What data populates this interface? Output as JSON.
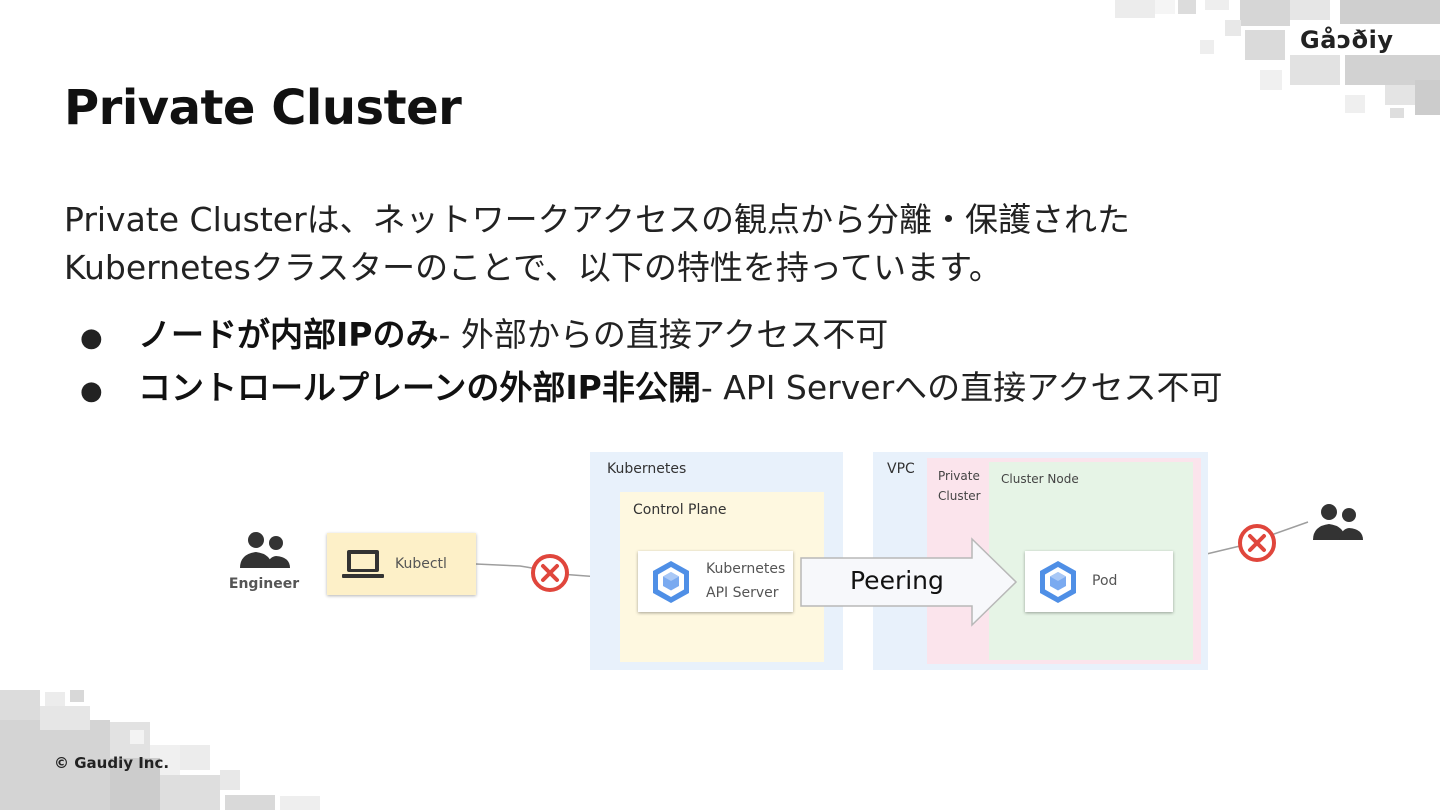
{
  "brand": {
    "logo_text": "Gåↄðiy",
    "copyright": "© Gaudiy Inc."
  },
  "slide": {
    "title": "Private Cluster",
    "description_line1": "Private Clusterは、ネットワークアクセスの観点から分離・保護された",
    "description_line2": "Kubernetesクラスターのことで、以下の特性を持っています。",
    "bullets": [
      {
        "bold": "ノードが内部IPのみ",
        "rest": " - 外部からの直接アクセス不可"
      },
      {
        "bold": "コントロールプレーンの外部IP非公開",
        "rest": " - API Serverへの直接アクセス不可"
      }
    ]
  },
  "diagram": {
    "engineer_label": "Engineer",
    "kubectl_label": "Kubectl",
    "kubernetes_region": "Kubernetes",
    "control_plane": "Control Plane",
    "api_server_line1": "Kubernetes",
    "api_server_line2": "API Server",
    "peering_label": "Peering",
    "vpc_region": "VPC",
    "private_cluster_line1": "Private",
    "private_cluster_line2": "Cluster",
    "cluster_node": "Cluster Node",
    "pod_label": "Pod",
    "colors": {
      "kubernetes_bg": "#e8f1fb",
      "control_plane_bg": "#fef8e0",
      "private_cluster_bg": "#fbe4ec",
      "cluster_node_bg": "#e6f4e6",
      "blocked": "#e0463c",
      "kubectl_bg": "#fdf0c8",
      "k8s_icon": "#4f8fe6"
    }
  }
}
